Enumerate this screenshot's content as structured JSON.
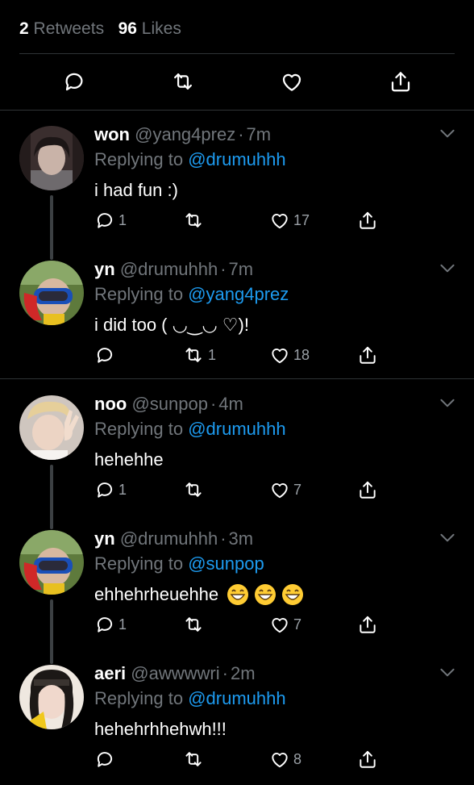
{
  "stats": {
    "retweets_count": "2",
    "retweets_label": "Retweets",
    "likes_count": "96",
    "likes_label": "Likes"
  },
  "actions": [
    "reply-icon",
    "retweet-icon",
    "like-icon",
    "share-icon"
  ],
  "colors": {
    "background": "#000000",
    "text": "#ffffff",
    "muted": "#71767b",
    "link": "#1d9bf0",
    "divider": "#2f3336"
  },
  "tweets": [
    {
      "name": "won",
      "handle": "@yang4prez",
      "dot": "·",
      "time": "7m",
      "replying_label": "Replying to",
      "replying_to": "@drumuhhh",
      "text": "i had fun :)",
      "reply_count": "1",
      "retweet_count": "",
      "like_count": "17"
    },
    {
      "name": "yn",
      "handle": "@drumuhhh",
      "dot": "·",
      "time": "7m",
      "replying_label": "Replying to",
      "replying_to": "@yang4prez",
      "text": "i did too ( ◡‿◡ ♡)!",
      "reply_count": "",
      "retweet_count": "1",
      "like_count": "18"
    },
    {
      "name": "noo",
      "handle": "@sunpop",
      "dot": "·",
      "time": "4m",
      "replying_label": "Replying to",
      "replying_to": "@drumuhhh",
      "text": "hehehhe",
      "reply_count": "1",
      "retweet_count": "",
      "like_count": "7"
    },
    {
      "name": "yn",
      "handle": "@drumuhhh",
      "dot": "·",
      "time": "3m",
      "replying_label": "Replying to",
      "replying_to": "@sunpop",
      "text": "ehhehrheuehhe",
      "emojis": [
        "grinning-face-emoji",
        "grinning-face-emoji",
        "grinning-face-emoji"
      ],
      "reply_count": "1",
      "retweet_count": "",
      "like_count": "7"
    },
    {
      "name": "aeri",
      "handle": "@awwwwri",
      "dot": "·",
      "time": "2m",
      "replying_label": "Replying to",
      "replying_to": "@drumuhhh",
      "text": "hehehrhhehwh!!!",
      "reply_count": "",
      "retweet_count": "",
      "like_count": "8"
    }
  ]
}
